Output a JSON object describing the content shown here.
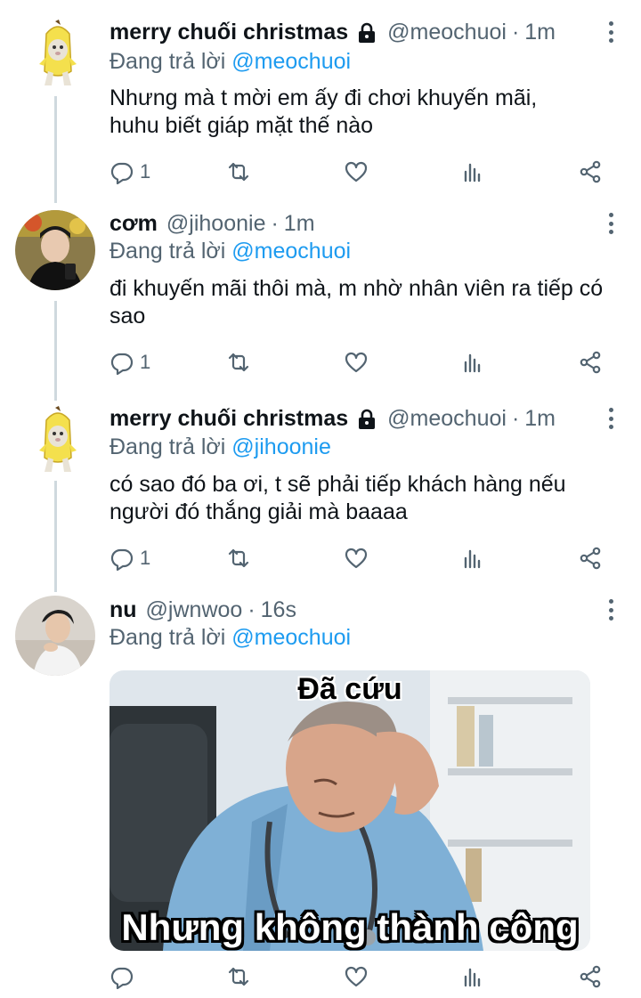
{
  "colors": {
    "text": "#0f1419",
    "secondary": "#536471",
    "link": "#1d9bf0",
    "thread_line": "#cfd9de"
  },
  "tweets": [
    {
      "name": "merry chuối christmas",
      "locked": true,
      "handle": "@meochuoi",
      "separator": "·",
      "time": "1m",
      "replying_prefix": "Đang trả lời",
      "replying_to": "@meochuoi",
      "text": "Nhưng mà t mời em ấy đi chơi khuyến mãi, huhu biết giáp mặt thế nào",
      "reply_count": "1",
      "avatar_icon": "banana-cat-avatar"
    },
    {
      "name": "cơm",
      "locked": false,
      "handle": "@jihoonie",
      "separator": "·",
      "time": "1m",
      "replying_prefix": "Đang trả lời",
      "replying_to": "@meochuoi",
      "text": "đi khuyến mãi thôi mà, m nhờ nhân viên ra tiếp có sao",
      "reply_count": "1",
      "avatar_icon": "profile-photo-avatar"
    },
    {
      "name": "merry chuối christmas",
      "locked": true,
      "handle": "@meochuoi",
      "separator": "·",
      "time": "1m",
      "replying_prefix": "Đang trả lời",
      "replying_to": "@jihoonie",
      "text": "có sao đó ba ơi, t sẽ phải tiếp khách hàng nếu người đó thắng giải mà baaaa",
      "reply_count": "1",
      "avatar_icon": "banana-cat-avatar"
    },
    {
      "name": "nu",
      "locked": false,
      "handle": "@jwnwoo",
      "separator": "·",
      "time": "16s",
      "replying_prefix": "Đang trả lời",
      "replying_to": "@meochuoi",
      "media": {
        "top_caption": "Đã cứu",
        "bottom_caption": "Nhưng không thành công"
      },
      "avatar_icon": "profile-photo-avatar"
    }
  ],
  "icons": {
    "reply": "reply-icon",
    "retweet": "retweet-icon",
    "like": "heart-icon",
    "views": "analytics-icon",
    "share": "share-icon",
    "lock": "lock-icon",
    "more": "more-icon"
  }
}
